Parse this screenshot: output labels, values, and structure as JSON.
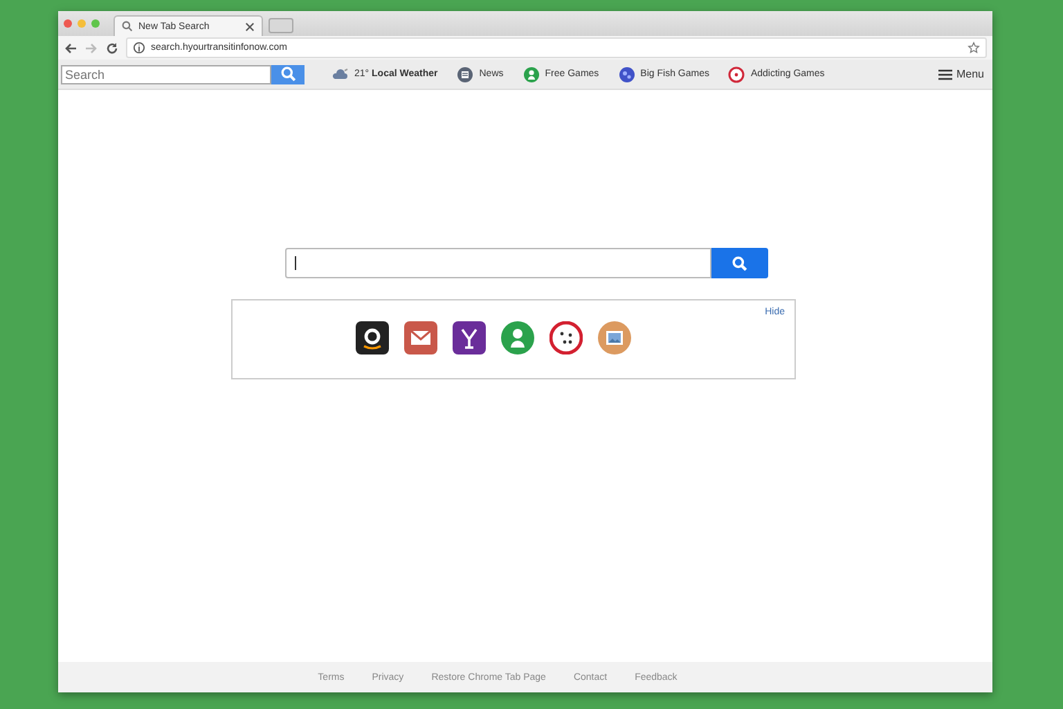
{
  "browser": {
    "tabs": [
      {
        "title": "New Tab Search",
        "selected": true
      },
      {
        "kind": "new",
        "selected": false
      }
    ],
    "address": "search.hyourtransitinfonow.com"
  },
  "toolbar": {
    "search": {
      "placeholder": "Search"
    },
    "links": [
      {
        "kind": "weather",
        "label": "21° **Local Weather**"
      },
      {
        "kind": "news",
        "label": "News"
      },
      {
        "kind": "person",
        "label": "Free Games"
      },
      {
        "kind": "fish",
        "label": "Big Fish Games"
      },
      {
        "kind": "target",
        "label": "Addicting Games"
      }
    ],
    "menu": "Menu"
  },
  "shortcuts": {
    "items": [
      {
        "kind": "amazon"
      },
      {
        "kind": "mail"
      },
      {
        "kind": "yahoo"
      },
      {
        "kind": "person"
      },
      {
        "kind": "dice"
      },
      {
        "kind": "photo"
      }
    ],
    "hide": "Hide"
  },
  "footer": [
    "Terms",
    "Privacy",
    "Restore Chrome Tab Page",
    "Contact",
    "Feedback"
  ]
}
